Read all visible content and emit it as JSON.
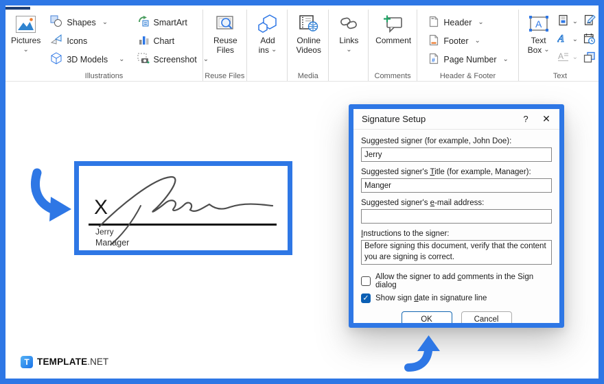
{
  "colors": {
    "accent_blue": "#2e77e5",
    "checkbox_checked": "#0b5fb4"
  },
  "ribbon": {
    "groups": {
      "illustrations": {
        "label": "Illustrations"
      },
      "reuse": {
        "label": "Reuse Files"
      },
      "media": {
        "label": "Media"
      },
      "comments": {
        "label": "Comments"
      },
      "header_footer": {
        "label": "Header & Footer"
      },
      "text": {
        "label": "Text"
      }
    },
    "buttons": {
      "pictures": "Pictures",
      "shapes": "Shapes",
      "icons": "Icons",
      "models3d": "3D Models",
      "smartart": "SmartArt",
      "chart": "Chart",
      "screenshot": "Screenshot",
      "reuse_files": "Reuse\nFiles",
      "add_ins": "Add\nins",
      "online_videos": "Online\nVideos",
      "links": "Links",
      "comment": "Comment",
      "header": "Header",
      "footer": "Footer",
      "page_number": "Page Number",
      "text_box": "Text\nBox"
    }
  },
  "canvas": {
    "signature": {
      "x_mark": "X",
      "signer_name": "Jerry",
      "signer_title": "Manager"
    }
  },
  "dialog": {
    "title": "Signature Setup",
    "help_glyph": "?",
    "close_glyph": "✕",
    "fields": [
      {
        "pre": "Suggested signer (for example, John Doe):",
        "key": "",
        "post": "",
        "value": "Jerry"
      },
      {
        "pre": "Suggested signer's ",
        "key": "T",
        "post": "itle (for example, Manager):",
        "value": "Manger"
      },
      {
        "pre": "Suggested signer's ",
        "key": "e",
        "post": "-mail address:",
        "value": ""
      },
      {
        "pre": "",
        "key": "I",
        "post": "nstructions to the signer:",
        "value": "Before signing this document, verify that the content you are signing is correct."
      }
    ],
    "checkboxes": [
      {
        "pre": "Allow the signer to add ",
        "key": "c",
        "post": "omments in the Sign dialog",
        "checked": false
      },
      {
        "pre": "Show sign ",
        "key": "d",
        "post": "ate in signature line",
        "checked": true,
        "check_glyph": "✓"
      }
    ],
    "buttons": {
      "ok": "OK",
      "cancel": "Cancel"
    }
  },
  "footer": {
    "logo_letter": "T",
    "brand_bold": "TEMPLATE",
    "brand_light": ".NET"
  }
}
